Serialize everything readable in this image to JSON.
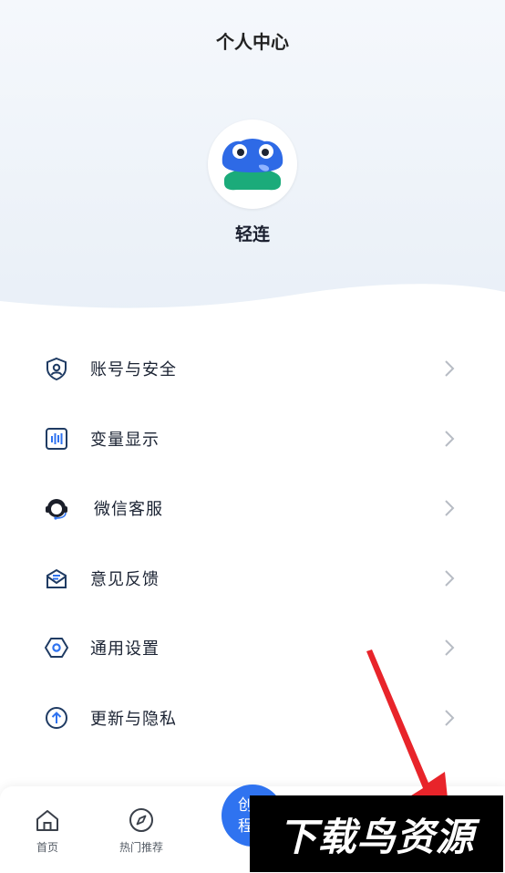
{
  "header": {
    "title": "个人中心"
  },
  "profile": {
    "name": "轻连"
  },
  "menu": {
    "items": [
      {
        "label": "账号与安全",
        "icon": "account-shield-icon"
      },
      {
        "label": "变量显示",
        "icon": "variable-display-icon"
      },
      {
        "label": "微信客服",
        "icon": "customer-service-icon"
      },
      {
        "label": "意见反馈",
        "icon": "feedback-mail-icon"
      },
      {
        "label": "通用设置",
        "icon": "settings-hexagon-icon"
      },
      {
        "label": "更新与隐私",
        "icon": "update-arrow-icon"
      }
    ]
  },
  "tabbar": {
    "home_label": "首页",
    "hot_label": "热门推荐",
    "center_line1": "创",
    "center_line2": "程"
  },
  "watermark": {
    "text": "下载鸟资源"
  },
  "colors": {
    "accent": "#2f73f0",
    "icon_navy": "#1f3b63",
    "frog_blue": "#2e6ae6",
    "frog_green": "#1bab7a",
    "arrow_red": "#e8242a"
  }
}
